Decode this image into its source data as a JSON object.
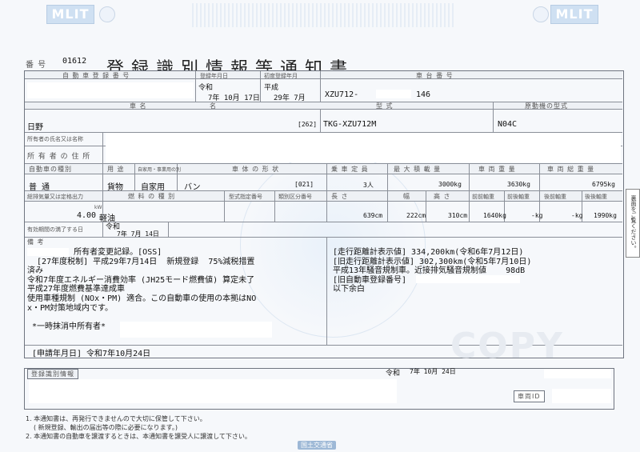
{
  "header": {
    "logo_left": "MLIT",
    "logo_right": "MLIT",
    "number_label": "番 号",
    "number_value": "01612",
    "title": "登録識別情報等通知書"
  },
  "row1": {
    "reg_no_label": "自 動 車 登 録 番 号",
    "reg_date_label": "登録年月日",
    "reg_date_era": "令和",
    "reg_date_value": "7年 10月 17日",
    "first_reg_label": "初度登録年月",
    "first_reg_era": "平成",
    "first_reg_value": "29年 7月",
    "chassis_label": "車 台 番 号",
    "chassis_prefix": "XZU712-",
    "chassis_suffix": "146"
  },
  "row2": {
    "name_label": "車 名",
    "model_label": "型 式",
    "engine_label": "原動機の型式",
    "name_value": "日野",
    "model_code": "[262]",
    "model_value": "TKG-XZU712M",
    "engine_value": "N04C"
  },
  "owners": {
    "user_label": "所有者の氏名又は名称",
    "address_label": "所 有 者 の 住 所"
  },
  "row3": {
    "kind_label": "自動車の種別",
    "use_label": "用 途",
    "business_label": "自家用・事業用の別",
    "body_label": "車 体 の 形 状",
    "capacity_label": "乗 車 定 員",
    "load_label": "最 大 積 載 量",
    "weight_label": "車 両 重 量",
    "gross_label": "車 両 総 重 量",
    "kind_value": "普 通",
    "use_value": "貨物",
    "business_value": "自家用",
    "body_value": "バン",
    "body_code": "[021]",
    "capacity_value": "3人",
    "load_value": "3000kg",
    "weight_value": "3630kg",
    "gross_value": "6795kg"
  },
  "row4": {
    "displacement_label": "総排気量又は定格出力",
    "fuel_label": "燃 料 の 種 別",
    "type_no_label": "型式指定番号",
    "class_no_label": "類別区分番号",
    "length_label": "長 さ",
    "width_label": "幅",
    "height_label": "高 さ",
    "ff_label": "前前軸重",
    "fr_label": "前後軸重",
    "rf_label": "後前軸重",
    "rr_label": "後後軸重",
    "displacement_value": "4.00",
    "displacement_unit": "kW",
    "fuel_value": "軽油",
    "length_value": "639cm",
    "width_value": "222cm",
    "height_value": "310cm",
    "ff_value": "1640kg",
    "fr_value": "-kg",
    "rf_value": "-kg",
    "rr_value": "1990kg"
  },
  "expiry": {
    "label": "有効期間の満了する日",
    "era": "令和",
    "value": "7年 7月 14日"
  },
  "remarks": {
    "label": "備 考",
    "left": "        。所有者変更記録。[OSS]\n  [27年度税制] 平成29年7月14日  新規登録  75%減税措置\n済み\n令和7年度エネルギー消費効率 (JH25モード燃費値) 算定未了\n平成27年度燃費基準達成車\n使用車種規制 (NOx・PM) 適合。この自動車の使用の本拠はNO\nx・PM対策地域内です。\n\n *一時抹消中所有者*",
    "right": "[走行距離計表示値] 334,200km(令和6年7月12日)\n[旧走行距離計表示値] 302,300km(令和5年7月10日)\n平成13年騒音規制車。近接排気騒音規制値    98dB\n[旧自動車登録番号]\n以下余白",
    "application": "[申請年月日] 令和7年10月24日"
  },
  "bottom": {
    "info_label": "登録識別情報",
    "date_era": "令和",
    "date_value": "7年 10月 24日",
    "watermark": "COPY",
    "car_id_label": "車両ID",
    "note1": "1. 本通知書は、再発行できませんので大切に保管して下さい。",
    "note1b": "( 新規登録、輸出の届出等の際に必要になります。)",
    "note2": "2. 本通知書の自動車を譲渡するときは、本通知書を譲受人に譲渡して下さい。",
    "ministry": "国土交通省",
    "side_note": "裏面をご覧ください。"
  }
}
